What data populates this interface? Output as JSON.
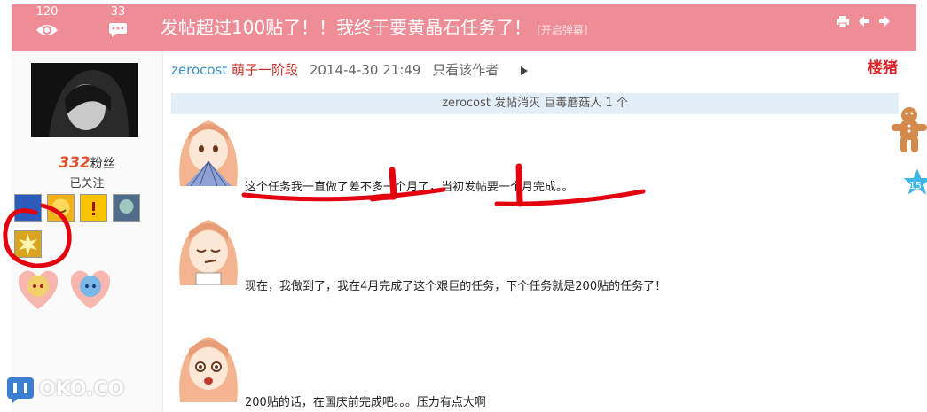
{
  "header": {
    "views_count": "120",
    "comments_count": "33",
    "title": "发帖超过100贴了！！我终于要黄晶石任务了！",
    "danmu_label": "[开启弹幕]",
    "bg_color": "#ef8d97"
  },
  "author": {
    "fans_count": "332",
    "fans_label": "粉丝",
    "follow_status": "已关注"
  },
  "post": {
    "username": "zerocost",
    "rank": "萌子一阶段",
    "date": "2014-4-30 21:49",
    "only_author": "只看该作者",
    "floor_label": "楼猪",
    "gift_line": "zerocost 发帖消灭  巨毒蘑菇人  1 个",
    "paragraphs": [
      "这个任务我一直做了差不多一个月了，当初发帖要一个月完成。。",
      "现在，我做到了，我在4月完成了这个艰巨的任务，下个任务就是200贴的任务了！",
      "200贴的话，在国庆前完成吧。。。压力有点大啊"
    ]
  },
  "side": {
    "star_number": "15"
  },
  "watermark": "OKO.CO"
}
